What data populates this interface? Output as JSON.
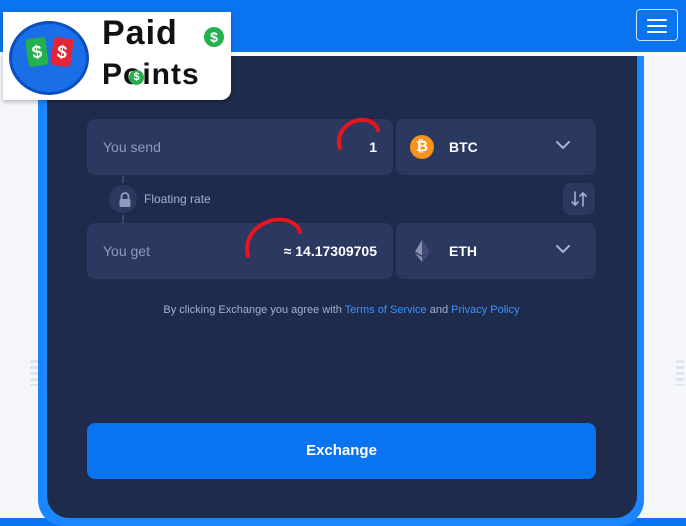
{
  "header": {
    "menu_icon": "hamburger-icon",
    "logo": {
      "word1": "Paid",
      "word2": "Points",
      "currency_symbol": "$",
      "icon": "money-bills-icon"
    }
  },
  "exchange": {
    "send": {
      "label": "You send",
      "amount": "1",
      "currency": "BTC",
      "currency_icon": "bitcoin-icon",
      "coin_glyph": "₿"
    },
    "get": {
      "label": "You get",
      "amount": "≈ 14.17309705",
      "currency": "ETH",
      "currency_icon": "ethereum-icon"
    },
    "rate_label": "Floating rate",
    "swap_icon": "swap-arrows-icon",
    "lock_icon": "lock-icon",
    "terms": {
      "prefix": "By clicking Exchange you agree with ",
      "tos_link": "Terms of Service",
      "and": " and ",
      "privacy_link": "Privacy Policy"
    },
    "button_label": "Exchange"
  },
  "colors": {
    "brand_blue": "#0a74f0",
    "card_bg": "#1f2b4d",
    "field_bg": "#2b3860",
    "link": "#3a94ff",
    "btc_orange": "#f7931a",
    "annotation_red": "#e8141e"
  }
}
